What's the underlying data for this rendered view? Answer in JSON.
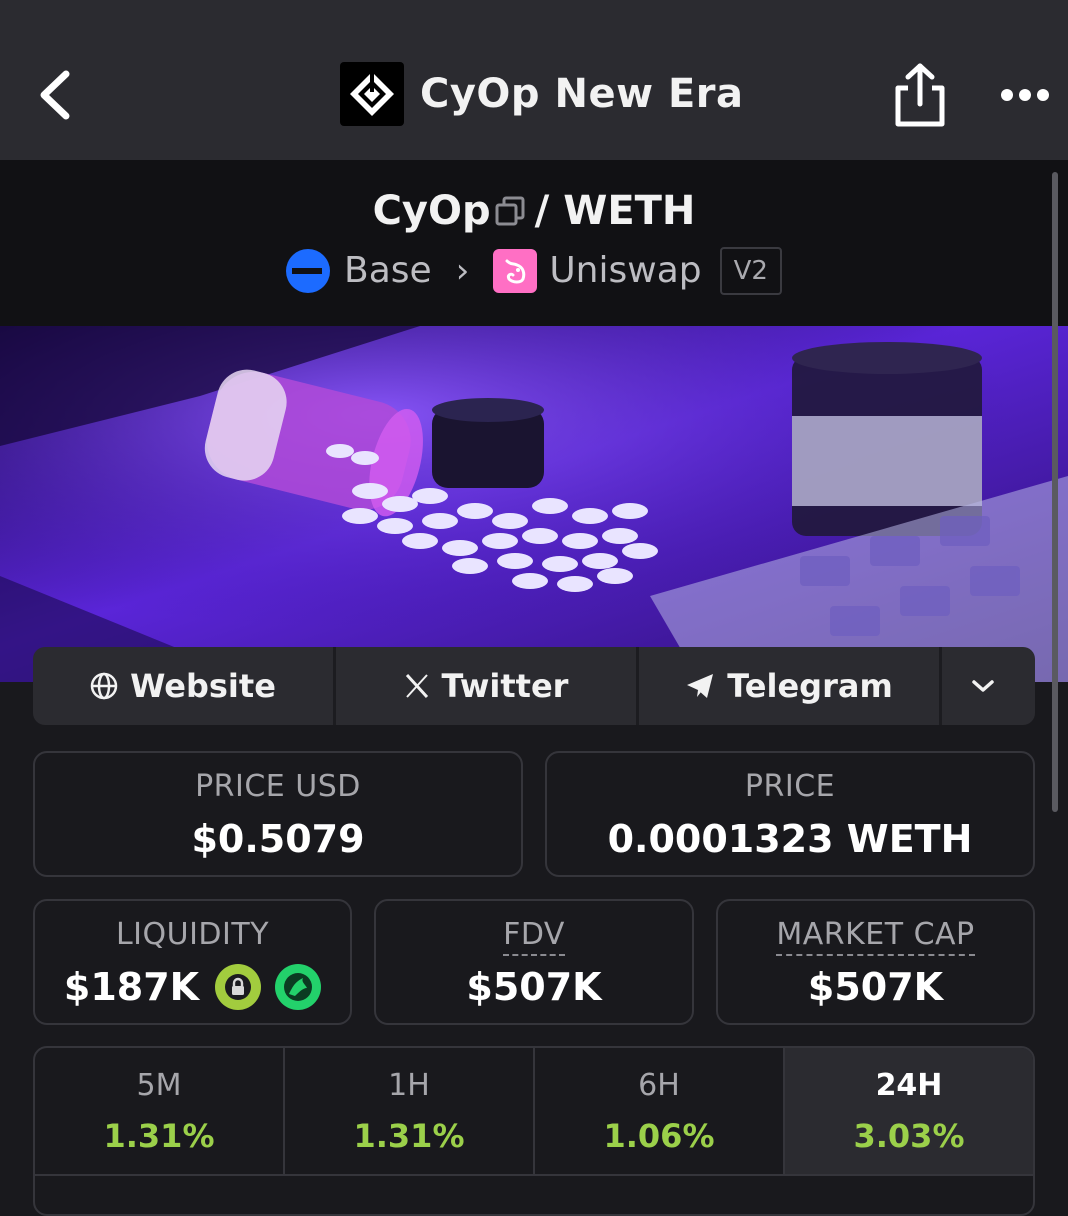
{
  "nav": {
    "title": "CyOp New Era",
    "back_icon": "chevron-left-icon",
    "share_icon": "share-icon",
    "more_icon": "more-icon"
  },
  "pair": {
    "base_token": "CyOp",
    "separator": "/",
    "quote_token": "WETH",
    "chain": "Base",
    "dex": "Uniswap",
    "version": "V2"
  },
  "socials": {
    "website": "Website",
    "twitter": "Twitter",
    "telegram": "Telegram"
  },
  "stats": {
    "price_usd_label": "PRICE USD",
    "price_usd": "$0.5079",
    "price_label": "PRICE",
    "price": "0.0001323 WETH",
    "liquidity_label": "LIQUIDITY",
    "liquidity": "$187K",
    "fdv_label": "FDV",
    "fdv": "$507K",
    "mcap_label": "MARKET CAP",
    "mcap": "$507K"
  },
  "timeframes": [
    {
      "label": "5M",
      "value": "1.31%"
    },
    {
      "label": "1H",
      "value": "1.31%"
    },
    {
      "label": "6H",
      "value": "1.06%"
    },
    {
      "label": "24H",
      "value": "3.03%"
    }
  ],
  "active_timeframe": "24H",
  "colors": {
    "positive": "#9bd04a",
    "accent_base": "#1c6bff",
    "accent_uniswap": "#ff6fc4"
  }
}
